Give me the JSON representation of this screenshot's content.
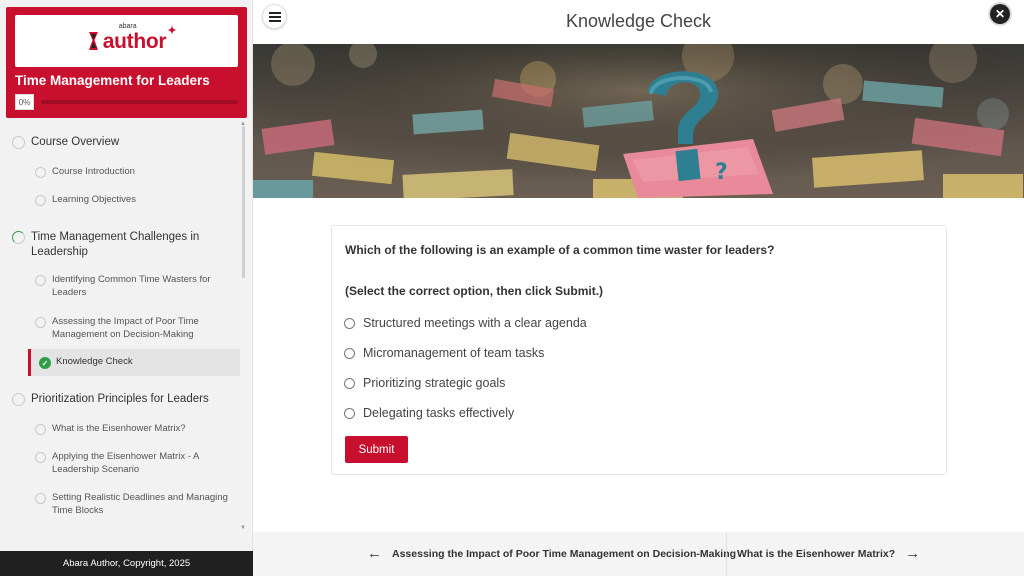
{
  "brand": {
    "logo_small": "abara",
    "logo_text": "author",
    "course_title": "Time Management for Leaders",
    "progress_label": "0%",
    "progress_fraction": 0.0
  },
  "sidebar": {
    "sections": [
      {
        "label": "Course Overview",
        "lessons": [
          "Course Introduction",
          "Learning Objectives"
        ]
      },
      {
        "label_line1": "Time Management Challenges in",
        "label_line2": "Leadership",
        "lessons": [
          {
            "line1": "Identifying Common Time Wasters for",
            "line2": "Leaders"
          },
          {
            "line1": "Assessing the Impact of Poor Time",
            "line2": "Management on Decision-Making"
          }
        ],
        "active_lesson": "Knowledge Check"
      },
      {
        "label": "Prioritization Principles for Leaders",
        "lessons": [
          {
            "line1": "What is the Eisenhower Matrix?"
          },
          {
            "line1": "Applying the Eisenhower Matrix - A",
            "line2": "Leadership Scenario"
          },
          {
            "line1": "Setting Realistic Deadlines and Managing",
            "line2": "Time Blocks"
          }
        ]
      }
    ],
    "footer": "Abara Author, Copyright, 2025"
  },
  "header": {
    "title": "Knowledge Check"
  },
  "quiz": {
    "question": "Which of the following is an example of a common time waster for leaders?",
    "instruction": "(Select the correct option, then click Submit.)",
    "options": [
      "Structured meetings with a clear agenda",
      "Micromanagement of team tasks",
      "Prioritizing strategic goals",
      "Delegating tasks effectively"
    ],
    "submit_label": "Submit"
  },
  "bottom_nav": {
    "prev_label": "Assessing the Impact of Poor Time Management on Decision-Making",
    "next_label": "What is the Eisenhower Matrix?"
  },
  "colors": {
    "brand_red": "#c8102e",
    "complete_green": "#2e9e47",
    "footer_dark": "#202020"
  },
  "icons": {
    "menu": "hamburger-icon",
    "close": "close-icon",
    "prev": "arrow-left-icon",
    "next": "arrow-right-icon",
    "complete": "check-circle-icon"
  }
}
